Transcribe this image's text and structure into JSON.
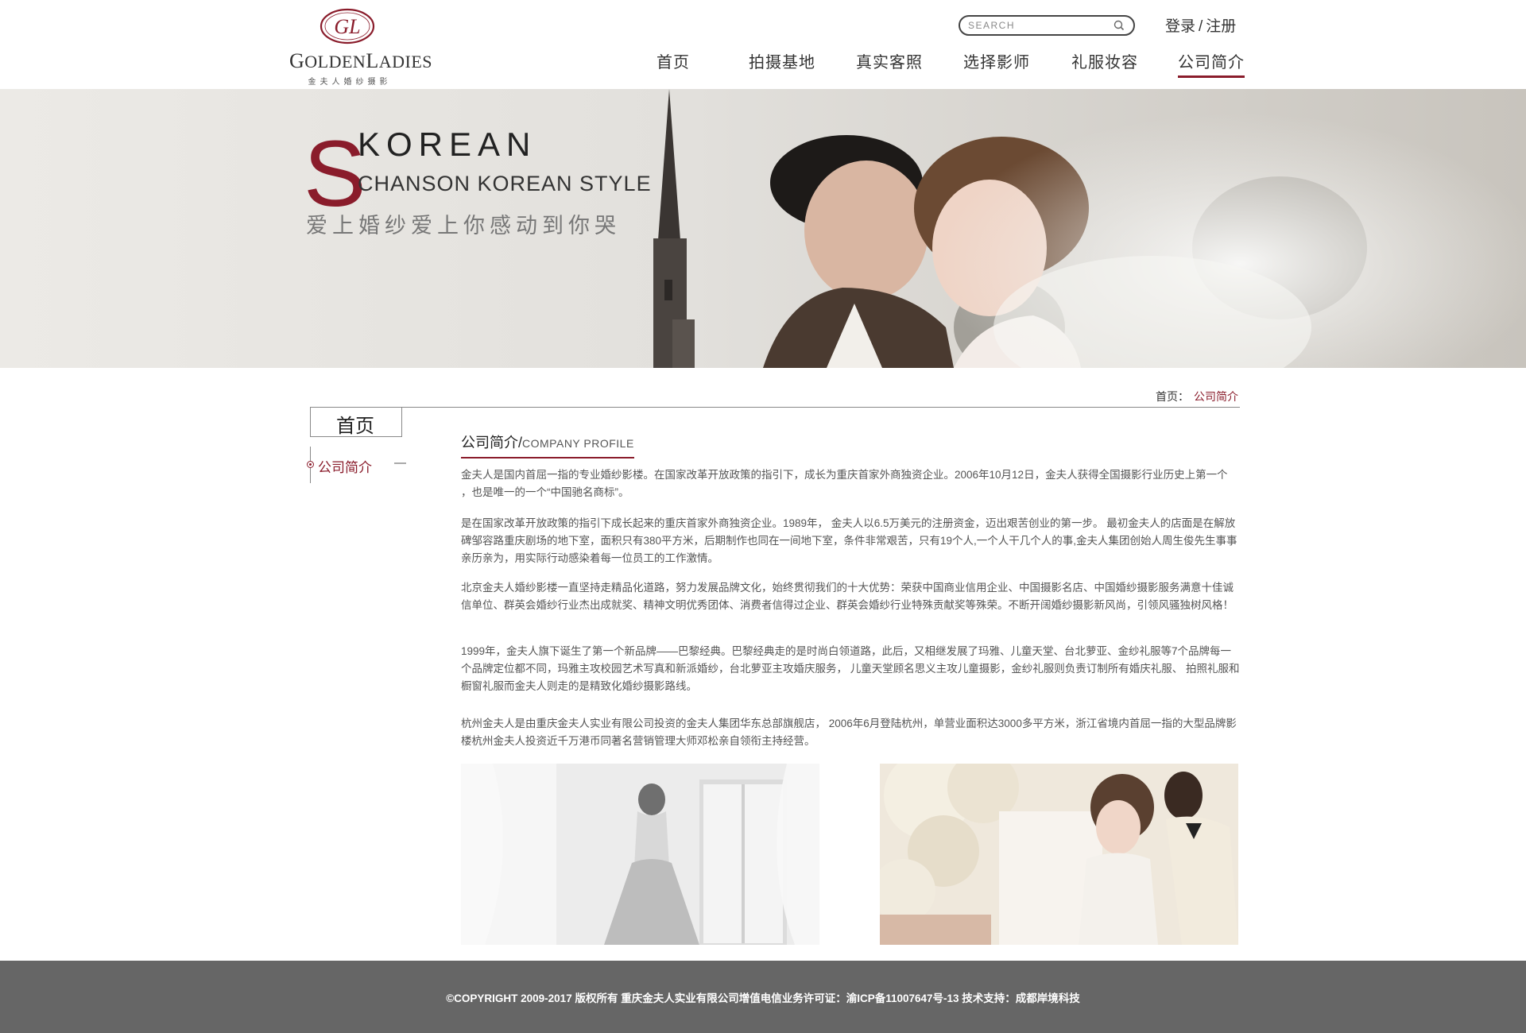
{
  "header": {
    "logo_brand_initial_g": "G",
    "logo_brand_rest_g": "OLDEN",
    "logo_brand_initial_l": "L",
    "logo_brand_rest_l": "ADIES",
    "logo_monogram": "GL",
    "logo_subtitle": "金夫人婚纱摄影",
    "search_placeholder": "SEARCH",
    "login": "登录",
    "auth_separator": "/",
    "register": "注册",
    "nav": [
      "首页",
      "拍摄基地",
      "真实客照",
      "选择影师",
      "礼服妆容",
      "公司简介"
    ],
    "active_nav": "公司简介"
  },
  "banner": {
    "big_letter": "S",
    "title": "KOREAN",
    "subtitle": "CHANSON KOREAN STYLE",
    "slogan": "爱上婚纱爱上你感动到你哭"
  },
  "breadcrumb": {
    "home": "首页：",
    "current": "公司简介"
  },
  "sidebar": {
    "title": "首页",
    "items": [
      {
        "label": "公司简介",
        "suffix": "—"
      }
    ]
  },
  "main": {
    "section_title_cn": "公司简介",
    "section_title_slash": "/",
    "section_title_en": "COMPANY PROFILE",
    "paragraphs": [
      "金夫人是国内首屈一指的专业婚纱影楼。在国家改革开放政策的指引下，成长为重庆首家外商独资企业。2006年10月12日，金夫人获得全国摄影行业历史上第一个 ，也是唯一的一个“中国驰名商标”。",
      "是在国家改革开放政策的指引下成长起来的重庆首家外商独资企业。1989年， 金夫人以6.5万美元的注册资金，迈出艰苦创业的第一步。 最初金夫人的店面是在解放碑邹容路重庆剧场的地下室，面积只有380平方米，后期制作也同在一间地下室，条件非常艰苦，只有19个人,一个人干几个人的事,金夫人集团创始人周生俊先生事事亲历亲为，用实际行动感染着每一位员工的工作激情。",
      "北京金夫人婚纱影楼一直坚持走精品化道路，努力发展品牌文化，始终贯彻我们的十大优势：荣获中国商业信用企业、中国摄影名店、中国婚纱摄影服务满意十佳诚信单位、群英会婚纱行业杰出成就奖、精神文明优秀团体、消费者信得过企业、群英会婚纱行业特殊贡献奖等殊荣。不断开阔婚纱摄影新风尚，引领风骚独树风格！",
      "1999年，金夫人旗下诞生了第一个新品牌——巴黎经典。巴黎经典走的是时尚白领道路，此后，又相继发展了玛雅、儿童天堂、台北萝亚、金纱礼服等7个品牌每一个品牌定位都不同，玛雅主攻校园艺术写真和新派婚纱，台北萝亚主攻婚庆服务， 儿童天堂顾名思义主攻儿童摄影，金纱礼服则负责订制所有婚庆礼服、 拍照礼服和橱窗礼服而金夫人则走的是精致化婚纱摄影路线。",
      "杭州金夫人是由重庆金夫人实业有限公司投资的金夫人集团华东总部旗舰店， 2006年6月登陆杭州，单营业面积达3000多平方米，浙江省境内首屈一指的大型品牌影楼杭州金夫人投资近千万港币同著名营销管理大师邓松亲自领衔主持经营。"
    ]
  },
  "footer": {
    "copyright": "©COPYRIGHT 2009-2017 版权所有 重庆金夫人实业有限公司增值电信业务许可证：渝ICP备11007647号-13  技术支持：成都岸境科技"
  },
  "colors": {
    "accent": "#8a1c2b",
    "footer_bg": "#666666",
    "text": "#555555"
  }
}
